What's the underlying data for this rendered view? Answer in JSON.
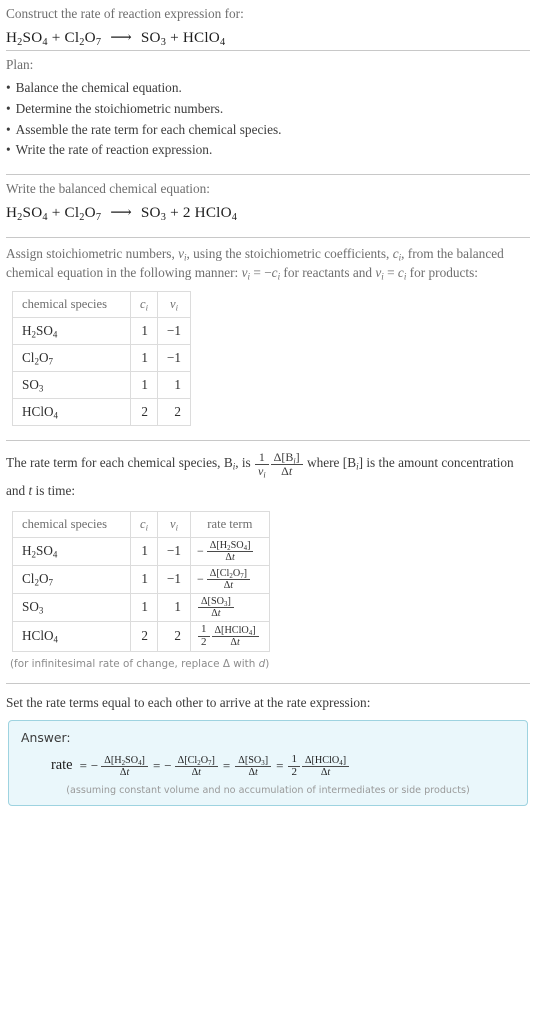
{
  "header": {
    "prompt": "Construct the rate of reaction expression for:",
    "equation": {
      "reactant1": "H2SO4",
      "plus1": "+",
      "reactant2": "Cl2O7",
      "arrow": "⟶",
      "product1": "SO3",
      "plus2": "+",
      "product2": "HClO4"
    }
  },
  "plan": {
    "title": "Plan:",
    "steps": [
      "Balance the chemical equation.",
      "Determine the stoichiometric numbers.",
      "Assemble the rate term for each chemical species.",
      "Write the rate of reaction expression."
    ]
  },
  "balanced": {
    "title": "Write the balanced chemical equation:",
    "equation": {
      "reactant1": "H2SO4",
      "plus1": "+",
      "reactant2": "Cl2O7",
      "arrow": "⟶",
      "product1": "SO3",
      "plus2": "+",
      "product2_coef": "2",
      "product2": "HClO4"
    }
  },
  "assign": {
    "text_part1": "Assign stoichiometric numbers, ",
    "nu_i": "ν",
    "text_part2": ", using the stoichiometric coefficients, ",
    "c_i": "c",
    "text_part3": ", from the balanced chemical equation in the following manner: ",
    "rule_reactants": "ν = −c",
    "text_part4": " for reactants and ",
    "rule_products": "ν = c",
    "text_part5": " for products:"
  },
  "table_stoich": {
    "headers": [
      "chemical species",
      "c",
      "ν"
    ],
    "rows": [
      {
        "species": "H2SO4",
        "c": "1",
        "nu": "−1"
      },
      {
        "species": "Cl2O7",
        "c": "1",
        "nu": "−1"
      },
      {
        "species": "SO3",
        "c": "1",
        "nu": "1"
      },
      {
        "species": "HClO4",
        "c": "2",
        "nu": "2"
      }
    ]
  },
  "rateterm_intro": {
    "part1": "The rate term for each chemical species, ",
    "B_i": "B",
    "part2": ", is ",
    "formula_num": "1",
    "formula_den": "ν",
    "formula_delta_num": "Δ[B]",
    "formula_delta_den": "Δt",
    "part3": " where [B] is the amount concentration and ",
    "t": "t",
    "part4": " is time:"
  },
  "table_rate": {
    "headers": [
      "chemical species",
      "c",
      "ν",
      "rate term"
    ],
    "rows": [
      {
        "species": "H2SO4",
        "c": "1",
        "nu": "−1",
        "sign": "−",
        "coef": "",
        "numerator": "Δ[H2SO4]",
        "denominator": "Δt"
      },
      {
        "species": "Cl2O7",
        "c": "1",
        "nu": "−1",
        "sign": "−",
        "coef": "",
        "numerator": "Δ[Cl2O7]",
        "denominator": "Δt"
      },
      {
        "species": "SO3",
        "c": "1",
        "nu": "1",
        "sign": "",
        "coef": "",
        "numerator": "Δ[SO3]",
        "denominator": "Δt"
      },
      {
        "species": "HClO4",
        "c": "2",
        "nu": "2",
        "sign": "",
        "coef": "1/2",
        "numerator": "Δ[HClO4]",
        "denominator": "Δt"
      }
    ],
    "footnote": "(for infinitesimal rate of change, replace Δ with d)"
  },
  "final": {
    "intro": "Set the rate terms equal to each other to arrive at the rate expression:",
    "answer_label": "Answer:",
    "rate_word": "rate",
    "equals": "=",
    "terms": [
      {
        "sign": "−",
        "coef": "",
        "numerator": "Δ[H2SO4]",
        "denominator": "Δt"
      },
      {
        "sign": "−",
        "coef": "",
        "numerator": "Δ[Cl2O7]",
        "denominator": "Δt"
      },
      {
        "sign": "",
        "coef": "",
        "numerator": "Δ[SO3]",
        "denominator": "Δt"
      },
      {
        "sign": "",
        "coef": "1/2",
        "numerator": "Δ[HClO4]",
        "denominator": "Δt"
      }
    ],
    "note": "(assuming constant volume and no accumulation of intermediates or side products)"
  },
  "colors": {
    "answer_bg": "#eaf7fb",
    "answer_border": "#9ed3e0",
    "rule": "#c8c8c8",
    "muted_text": "#6e6e6e",
    "body_text": "#3b3b3b"
  }
}
